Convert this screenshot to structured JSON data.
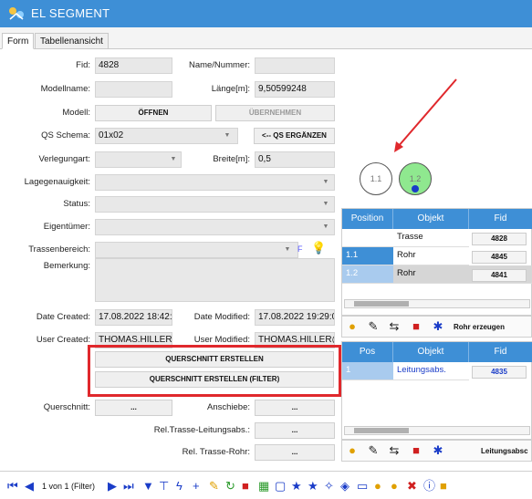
{
  "window": {
    "title": "EL SEGMENT"
  },
  "tabs": [
    {
      "label": "Form"
    },
    {
      "label": "Tabellenansicht"
    }
  ],
  "form": {
    "fid_label": "Fid:",
    "fid_value": "4828",
    "name_label": "Name/Nummer:",
    "name_value": "",
    "modellname_label": "Modellname:",
    "modellname_value": "",
    "laenge_label": "Länge[m]:",
    "laenge_value": "9,50599248",
    "modell_label": "Modell:",
    "oeffnen": "ÖFFNEN",
    "uebernehmen": "ÜBERNEHMEN",
    "qs_label": "QS Schema:",
    "qs_value": "01x02",
    "qs_ergaenzen": "<-- QS ERGÄNZEN",
    "verlegung_label": "Verlegungart:",
    "breite_label": "Breite[m]:",
    "breite_value": "0,5",
    "lage_label": "Lagegenauigkeit:",
    "status_label": "Status:",
    "eigentuemer_label": "Eigentümer:",
    "trassenbereich_label": "Trassenbereich:",
    "trassen_f": "F",
    "bemerkung_label": "Bemerkung:",
    "date_created_label": "Date Created:",
    "date_created_value": "17.08.2022 18:42:2",
    "date_modified_label": "Date Modified:",
    "date_modified_value": "17.08.2022 19:29:0",
    "user_created_label": "User Created:",
    "user_created_value": "THOMAS.HILLER@",
    "user_modified_label": "User Modified:",
    "user_modified_value": "THOMAS.HILLER@",
    "btn_qs": "QUERSCHNITT ERSTELLEN",
    "btn_qs_filter": "QUERSCHNITT ERSTELLEN (FILTER)",
    "querschnitt_label": "Querschnitt:",
    "querschnitt_value": "...",
    "anschiebe_label": "Anschiebe:",
    "anschiebe_value": "...",
    "rel_tl_label": "Rel.Trasse-Leitungsabs.:",
    "rel_tl_value": "...",
    "rel_tr_label": "Rel. Trasse-Rohr:",
    "rel_tr_value": "..."
  },
  "diagram": {
    "circles": [
      {
        "label": "1.1",
        "color": "#ffffff"
      },
      {
        "label": "1.2",
        "color": "#8fe88f"
      }
    ],
    "arrow_color": "#e0282c",
    "dot_color": "#1a3cc8"
  },
  "grid1": {
    "headers": [
      "Position",
      "Objekt",
      "Fid"
    ],
    "rows": [
      {
        "pos": "",
        "obj": "Trasse",
        "fid": "4828"
      },
      {
        "pos": "1.1",
        "obj": "Rohr",
        "fid": "4845"
      },
      {
        "pos": "1.2",
        "obj": "Rohr",
        "fid": "4841"
      }
    ],
    "action": "Rohr erzeugen"
  },
  "grid2": {
    "headers": [
      "Pos",
      "Objekt",
      "Fid"
    ],
    "rows": [
      {
        "pos": "1",
        "obj": "Leitungsabs.",
        "fid": "4835"
      }
    ],
    "action": "Leitungsabsc"
  },
  "nav": {
    "record": "1 von 1 (Filter)"
  },
  "colors": {
    "accent": "#3e8fd6",
    "highlight": "#e0282c"
  }
}
